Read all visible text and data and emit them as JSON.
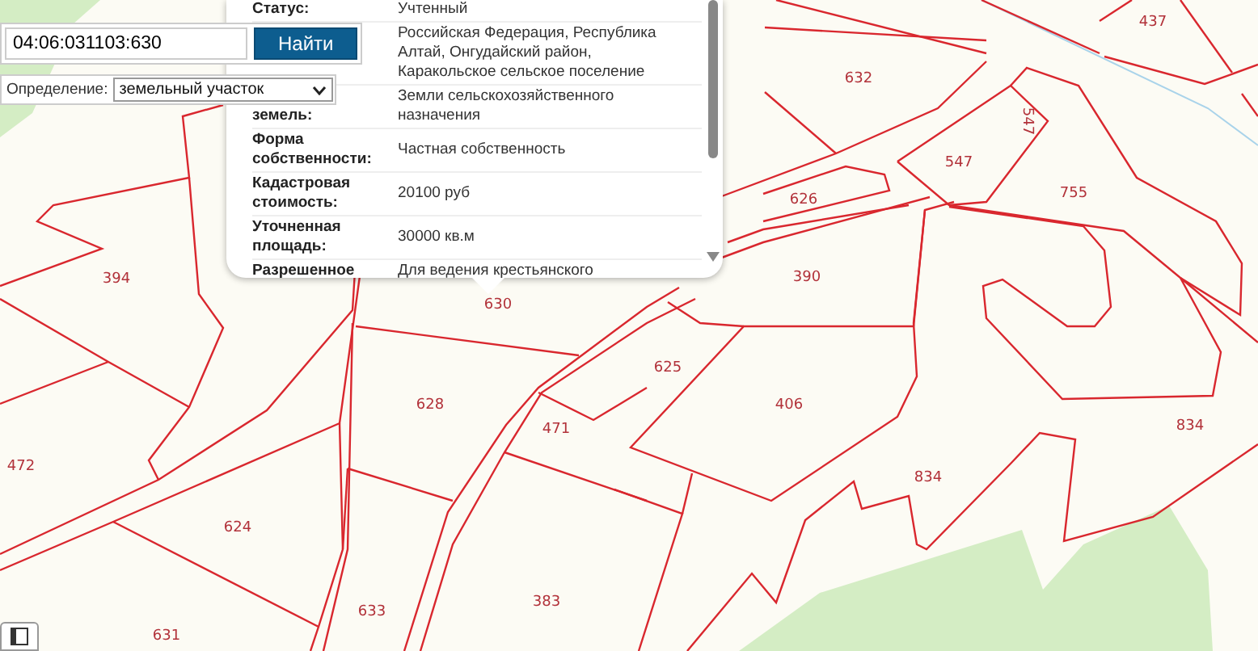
{
  "search": {
    "value": "04:06:031103:630",
    "button": "Найти"
  },
  "definition": {
    "label": "Определение:",
    "value": "земельный участок"
  },
  "popup": {
    "rows": [
      {
        "label": "Статус:",
        "value": "Учтенный"
      },
      {
        "label": "",
        "value": "Российская Федерация, Республика Алтай, Онгудайский район, Каракольское сельское поселение"
      },
      {
        "label": "земель:",
        "value": "Земли сельскохозяйственного назначения"
      },
      {
        "label": "Форма собственности:",
        "value": "Частная собственность"
      },
      {
        "label": "Кадастровая стоимость:",
        "value": "20100 руб"
      },
      {
        "label": "Уточненная площадь:",
        "value": "30000 кв.м"
      },
      {
        "label": "Разрешенное",
        "value": "Для ведения крестьянского"
      }
    ]
  },
  "parcels": [
    "437",
    "632",
    "547",
    "547",
    "626",
    "755",
    "390",
    "394",
    "630",
    "625",
    "628",
    "471",
    "406",
    "834",
    "834",
    "472",
    "624",
    "633",
    "383",
    "631"
  ]
}
